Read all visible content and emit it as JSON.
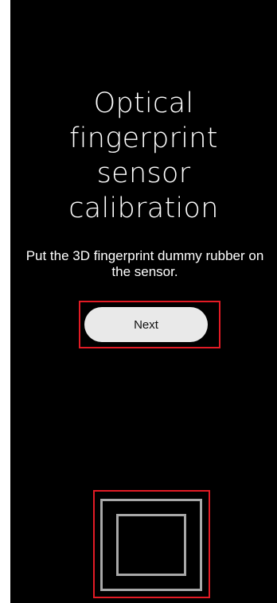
{
  "title": {
    "lines": [
      "Optical",
      "fingerprint",
      "sensor",
      "calibration"
    ]
  },
  "instruction": {
    "line1": "Put the 3D fingerprint dummy rubber on",
    "line2": "the sensor."
  },
  "next_button": {
    "label": "Next"
  },
  "sensor": {
    "icon": "fingerprint-sensor-target-icon"
  },
  "colors": {
    "background": "#000000",
    "text": "#ffffff",
    "button_fill": "#e9e9e9",
    "highlight_frame": "#e21b25",
    "sensor_outline": "#a8a8a8"
  }
}
